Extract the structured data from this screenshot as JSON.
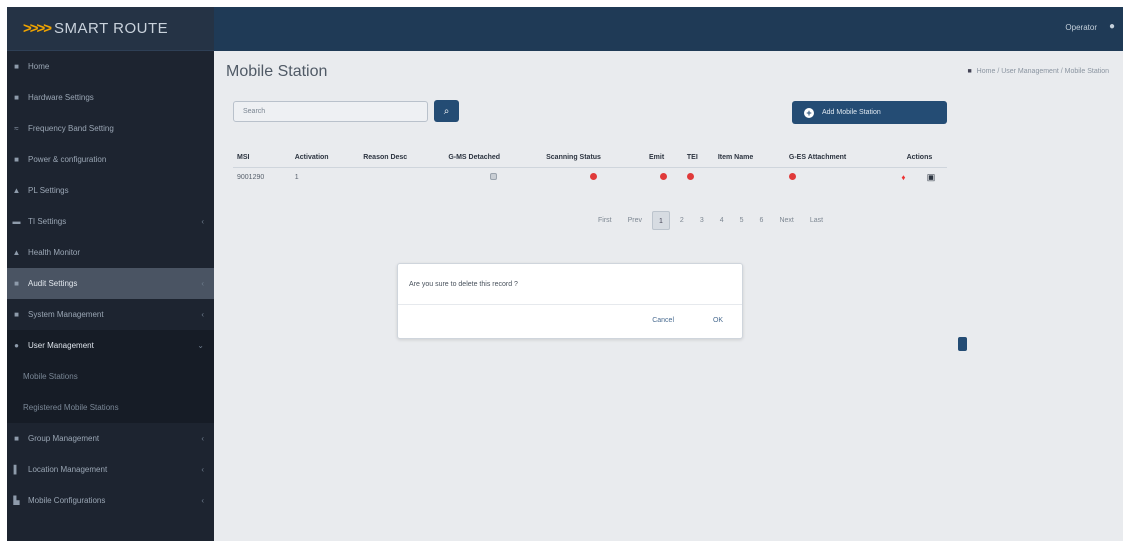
{
  "app": {
    "logo_mark": ">>>>",
    "logo_text": "SMART ROUTE"
  },
  "topbar": {
    "user": "Operator"
  },
  "sidebar": {
    "items": [
      {
        "label": "Home"
      },
      {
        "label": "Hardware Settings"
      },
      {
        "label": "Frequency Band Setting"
      },
      {
        "label": "Power & configuration"
      },
      {
        "label": "PL Settings"
      },
      {
        "label": "TI Settings"
      },
      {
        "label": "Health Monitor"
      },
      {
        "label": "Audit Settings"
      },
      {
        "label": "System Management"
      },
      {
        "label": "User Management"
      },
      {
        "label": "Mobile Stations"
      },
      {
        "label": "Registered Mobile Stations"
      },
      {
        "label": "Group Management"
      },
      {
        "label": "Location Management"
      },
      {
        "label": "Mobile Configurations"
      }
    ]
  },
  "page": {
    "title": "Mobile Station",
    "breadcrumb": [
      "Home",
      "User Management",
      "Mobile Station"
    ]
  },
  "search": {
    "value": "Search",
    "button_icon": "search-icon"
  },
  "add_button": {
    "label": "Add Mobile Station"
  },
  "table": {
    "headers": [
      "MSI",
      "Activation",
      "Reason Desc",
      "G-MS Detached",
      "Scanning Status",
      "Emit",
      "TEI",
      "Item Name",
      "G-ES Attachment",
      "Actions"
    ],
    "rows": [
      {
        "msi": "9001290",
        "activation": "1"
      }
    ]
  },
  "pagination": {
    "pages": [
      "First",
      "Prev",
      "1",
      "2",
      "3",
      "4",
      "5",
      "6",
      "Next",
      "Last"
    ],
    "current": "1"
  },
  "modal": {
    "message": "Are you sure to delete this record ?",
    "cancel": "Cancel",
    "ok": "OK"
  },
  "colors": {
    "sidebar_bg": "#1d2430",
    "topbar_bg": "#1f3a56",
    "primary": "#244c74",
    "danger": "#e03a3a"
  }
}
